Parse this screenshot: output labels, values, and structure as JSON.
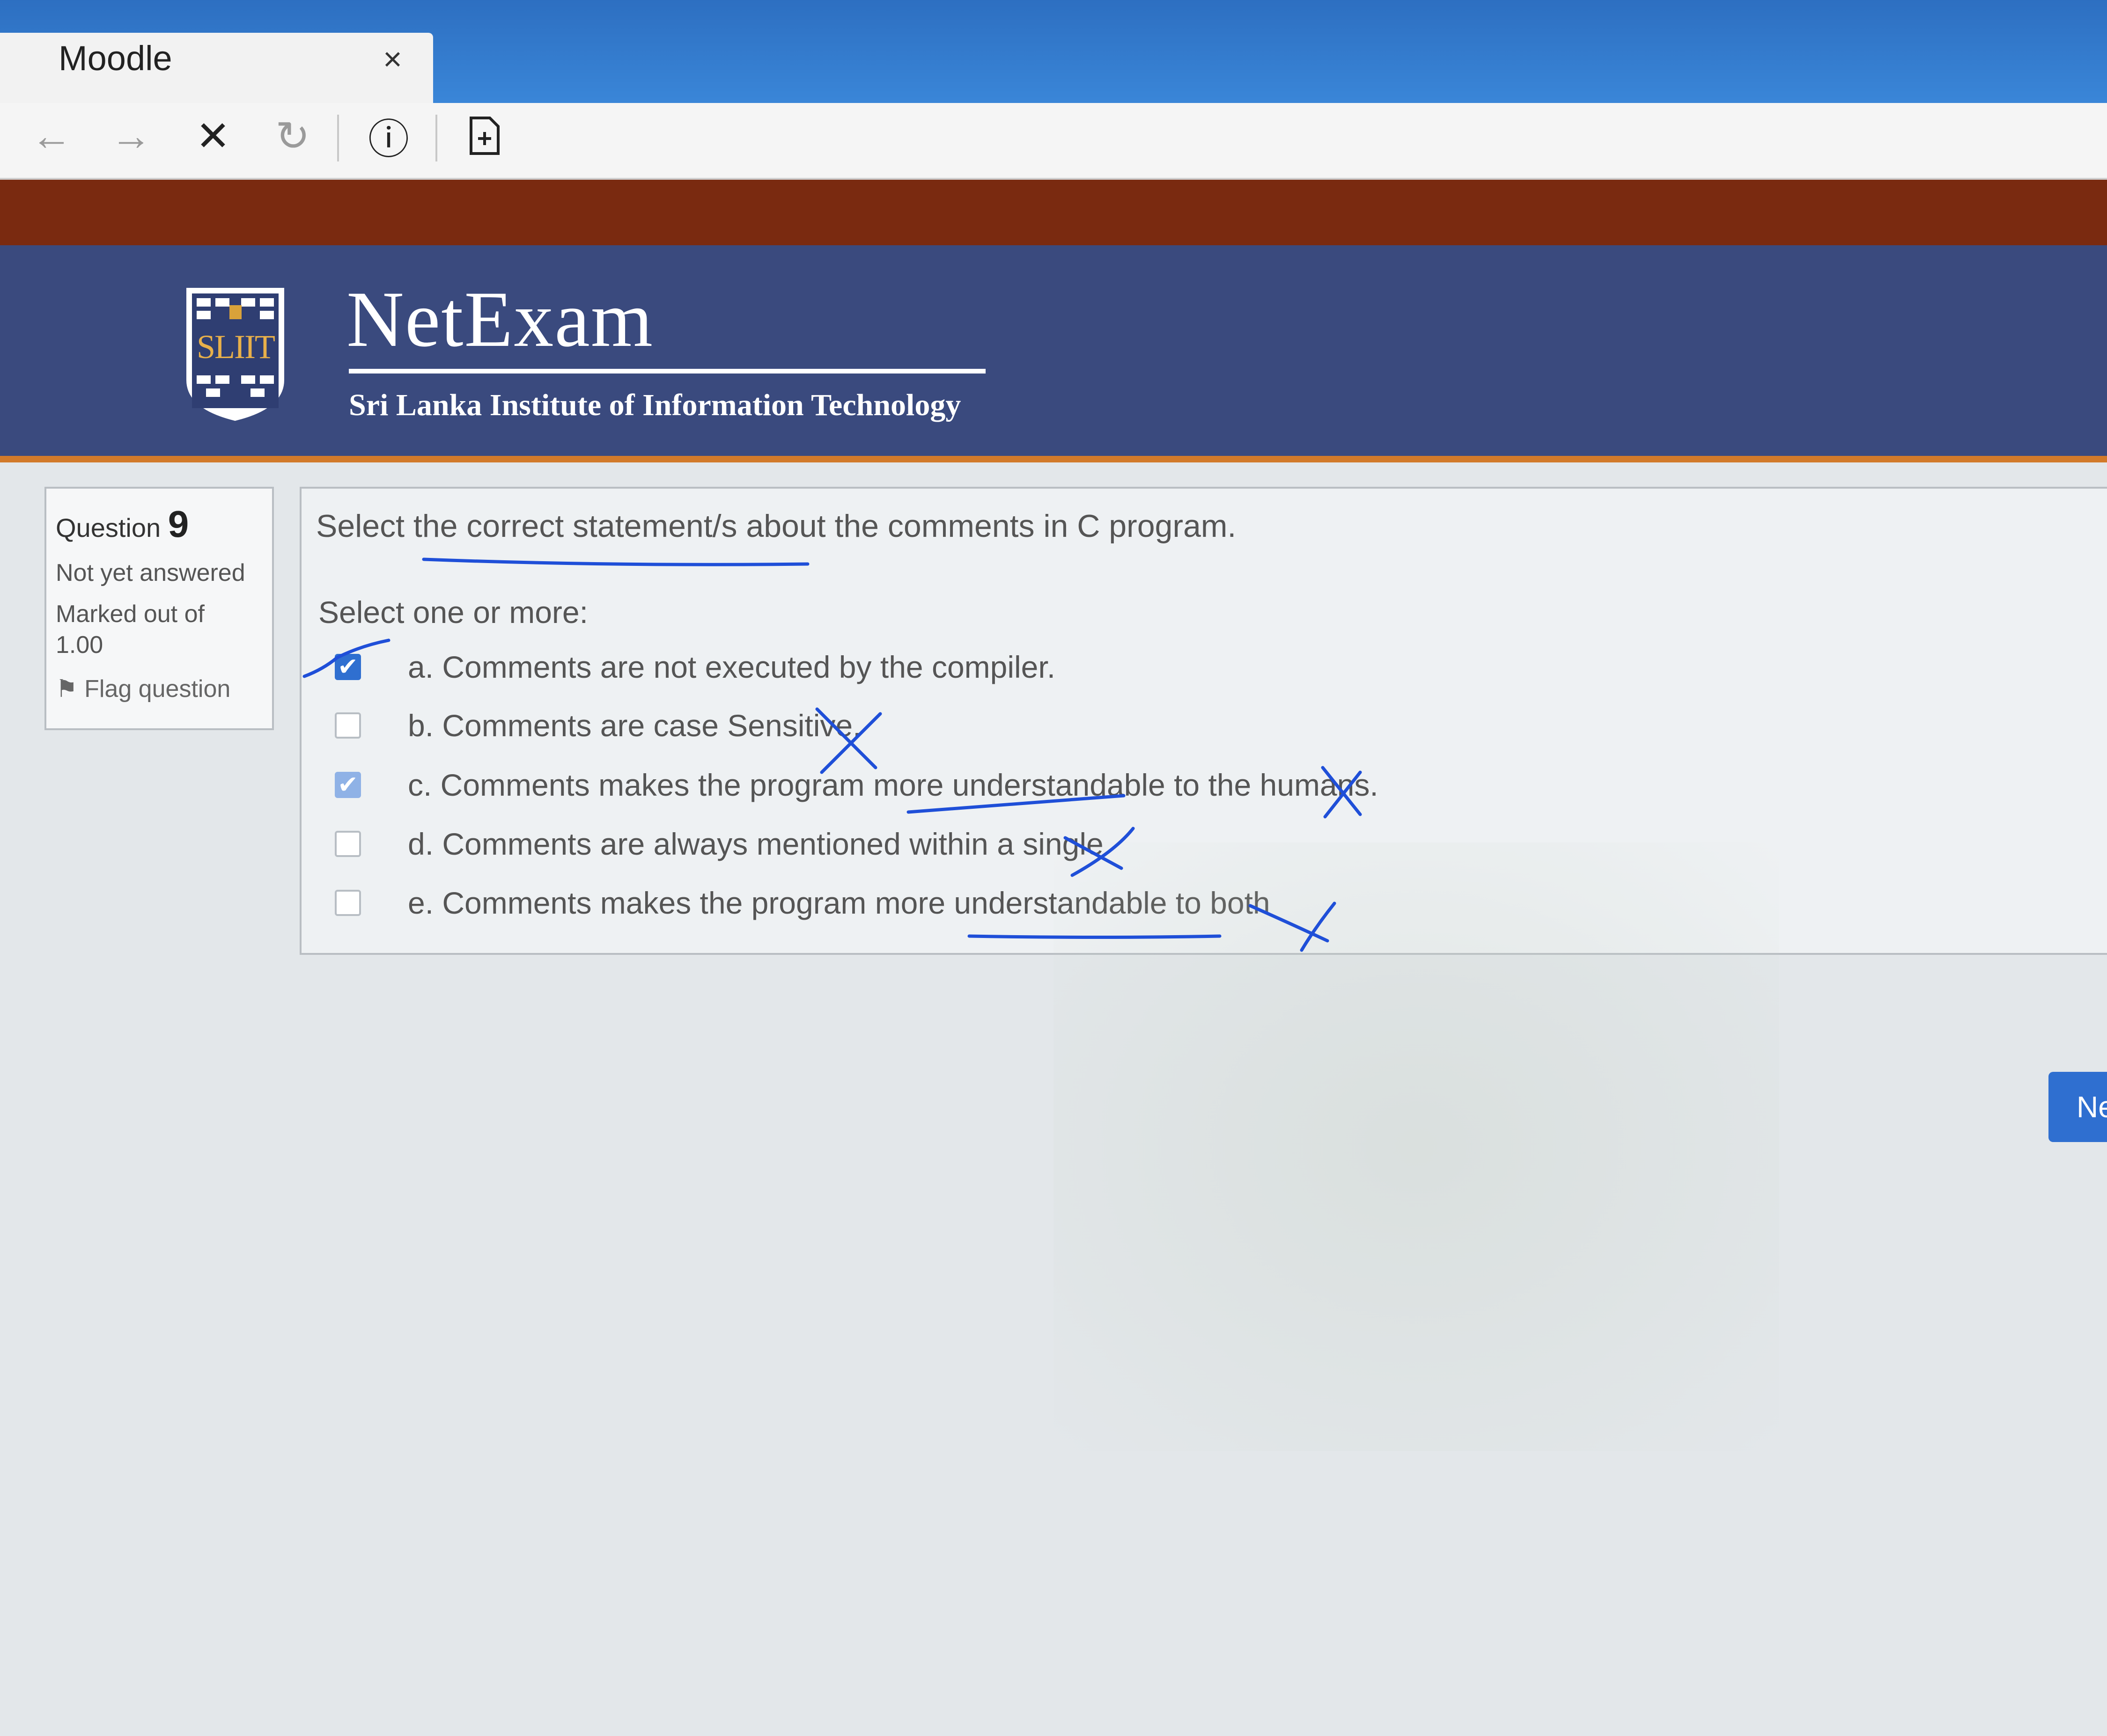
{
  "browser": {
    "tab_title": "Moodle",
    "tab_close": "×",
    "toolbar": {
      "back_icon": "←",
      "forward_icon": "→",
      "stop_icon": "✕",
      "reload_icon": "↻",
      "info_icon": "ⓘ"
    }
  },
  "banner": {
    "brand": "NetExam",
    "subtitle": "Sri Lanka Institute of Information Technology",
    "logo_text": "SLIIT",
    "colors": {
      "banner": "#3a4a7e",
      "accent": "#d27a2a"
    }
  },
  "info": {
    "question_label": "Question",
    "question_number": "9",
    "status": "Not yet answered",
    "marked_label": "Marked out of",
    "marked_value": "1.00",
    "flag_icon": "⚑",
    "flag_label": "Flag question"
  },
  "question": {
    "text": "Select the correct statement/s about the comments in C program.",
    "prompt": "Select one or more:",
    "answers": [
      {
        "label": "a. Comments are not executed by the compiler.",
        "checked": true
      },
      {
        "label": "b. Comments are case Sensitive.",
        "checked": false
      },
      {
        "label": "c. Comments makes the program more understandable to the humans.",
        "checked": true
      },
      {
        "label": "d. Comments are always mentioned within a single",
        "checked": false
      },
      {
        "label": "e. Comments makes the program more understandable to both",
        "checked": false
      }
    ]
  },
  "navigation": {
    "next_label": "Ne"
  },
  "colors": {
    "primary": "#2f6fd0",
    "annotation_ink": "#1f4fd8"
  }
}
